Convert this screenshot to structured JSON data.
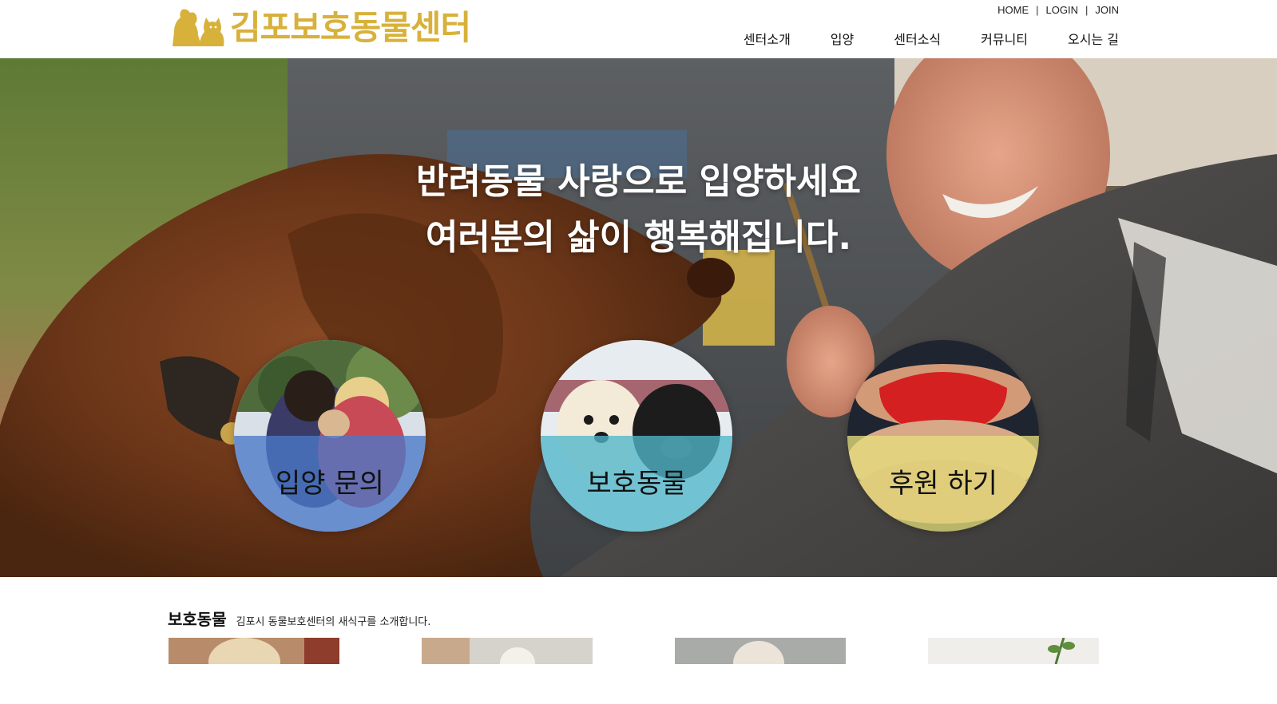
{
  "header": {
    "logo_text": "김포보호동물센터",
    "util_links": [
      "HOME",
      "LOGIN",
      "JOIN"
    ],
    "nav": [
      "센터소개",
      "입양",
      "센터소식",
      "커뮤니티",
      "오시는 길"
    ]
  },
  "hero": {
    "line1": "반려동물 사랑으로 입양하세요",
    "line2": "여러분의 삶이 행복해집니다.",
    "circles": [
      {
        "label": "입양 문의",
        "band_color": "#4a78c8"
      },
      {
        "label": "보호동물",
        "band_color": "#4fb6c9"
      },
      {
        "label": "후원 하기",
        "band_color": "#e6de7c"
      }
    ]
  },
  "section": {
    "title": "보호동물",
    "description": "김포시 동물보호센터의 새식구를 소개합니다."
  },
  "colors": {
    "brand": "#d8b13b"
  },
  "icons": {
    "logo": "dog-cat-silhouette-icon"
  }
}
